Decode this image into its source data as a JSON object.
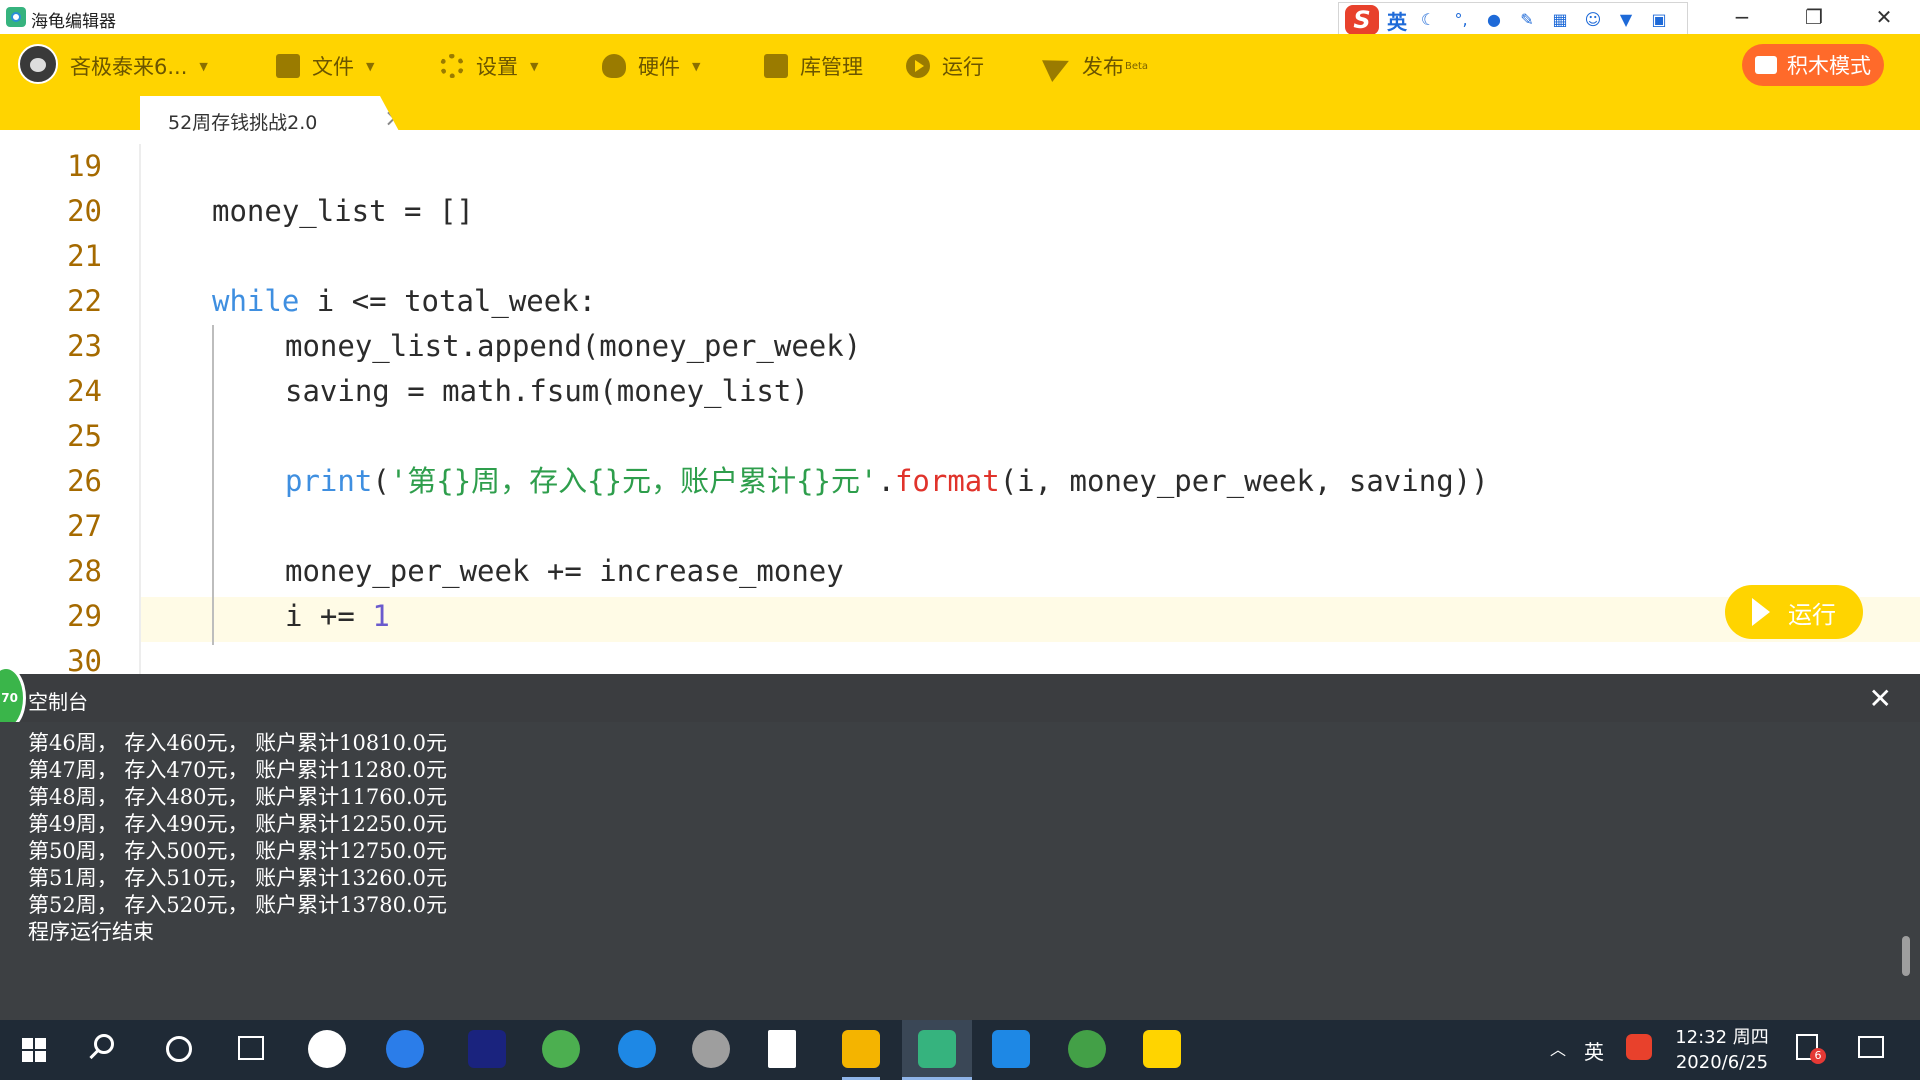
{
  "window": {
    "title": "海龟编辑器"
  },
  "ime": {
    "lang": "英"
  },
  "menubar": {
    "user": "吝极泰来6...",
    "file": "文件",
    "settings": "设置",
    "hardware": "硬件",
    "library": "库管理",
    "run": "运行",
    "publish": "发布",
    "publish_badge": "Beta",
    "block_mode": "积木模式"
  },
  "tab": {
    "label": "52周存钱挑战2.0",
    "close": "×"
  },
  "editor": {
    "lines": [
      {
        "num": "19",
        "code": ""
      },
      {
        "num": "20",
        "code": "money_list = []"
      },
      {
        "num": "21",
        "code": ""
      },
      {
        "num": "22",
        "kw": "while",
        "code": " i <= total_week:"
      },
      {
        "num": "23",
        "code": "money_list.append(money_per_week)"
      },
      {
        "num": "24",
        "code": "saving = math.fsum(money_list)"
      },
      {
        "num": "25",
        "code": ""
      },
      {
        "num": "26",
        "print": "print",
        "open": "(",
        "str": "'第{}周，存入{}元，账户累计{}元'",
        "dot": ".",
        "format": "format",
        "rest": "(i, money_per_week, saving))"
      },
      {
        "num": "27",
        "code": ""
      },
      {
        "num": "28",
        "code": "money_per_week += increase_money"
      },
      {
        "num": "29",
        "code": "i += ",
        "number": "1"
      },
      {
        "num": "30",
        "code": ""
      }
    ],
    "run_button": "运行"
  },
  "console": {
    "title": "空制台",
    "badge": "70",
    "lines": [
      "第46周， 存入460元， 账户累计10810.0元",
      "第47周， 存入470元， 账户累计11280.0元",
      "第48周， 存入480元， 账户累计11760.0元",
      "第49周， 存入490元， 账户累计12250.0元",
      "第50周， 存入500元， 账户累计12750.0元",
      "第51周， 存入510元， 账户累计13260.0元",
      "第52周， 存入520元， 账户累计13780.0元",
      "程序运行结束"
    ]
  },
  "taskbar": {
    "tray_lang": "英",
    "time": "12:32 周四",
    "date": "2020/6/25",
    "notifications": "6"
  },
  "colors": {
    "accent": "#ffd400",
    "block_mode": "#ff6a2a",
    "keyword": "#3f8fe0",
    "string": "#2e9e4c",
    "function": "#e0332b",
    "console_bg": "#3d4043"
  },
  "icons": [
    "app-icon",
    "user-avatar",
    "folder-icon",
    "gear-icon",
    "hardware-icon",
    "library-icon",
    "play-icon",
    "send-icon",
    "blocks-icon",
    "close-icon"
  ]
}
